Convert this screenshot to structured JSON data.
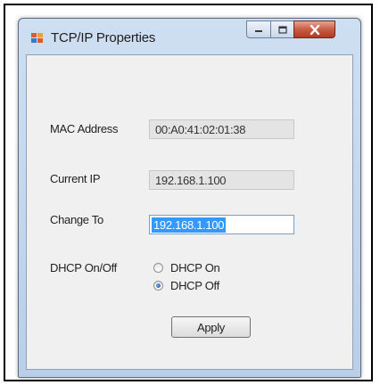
{
  "window": {
    "title": "TCP/IP Properties"
  },
  "fields": {
    "mac_label": "MAC Address",
    "mac_value": "00:A0:41:02:01:38",
    "current_ip_label": "Current IP",
    "current_ip_value": "192.168.1.100",
    "change_to_label": "Change To",
    "change_to_value": "192.168.1.100",
    "dhcp_label": "DHCP On/Off"
  },
  "dhcp": {
    "options": [
      {
        "label": "DHCP On",
        "selected": false
      },
      {
        "label": "DHCP Off",
        "selected": true
      }
    ]
  },
  "buttons": {
    "apply_label": "Apply"
  },
  "icons": {
    "app": "network-properties-icon",
    "minimize": "minimize-icon",
    "maximize": "maximize-icon",
    "close": "close-icon"
  },
  "colors": {
    "selection": "#3399ff",
    "close_button": "#c75c45",
    "titlebar": "#cfdff2"
  }
}
